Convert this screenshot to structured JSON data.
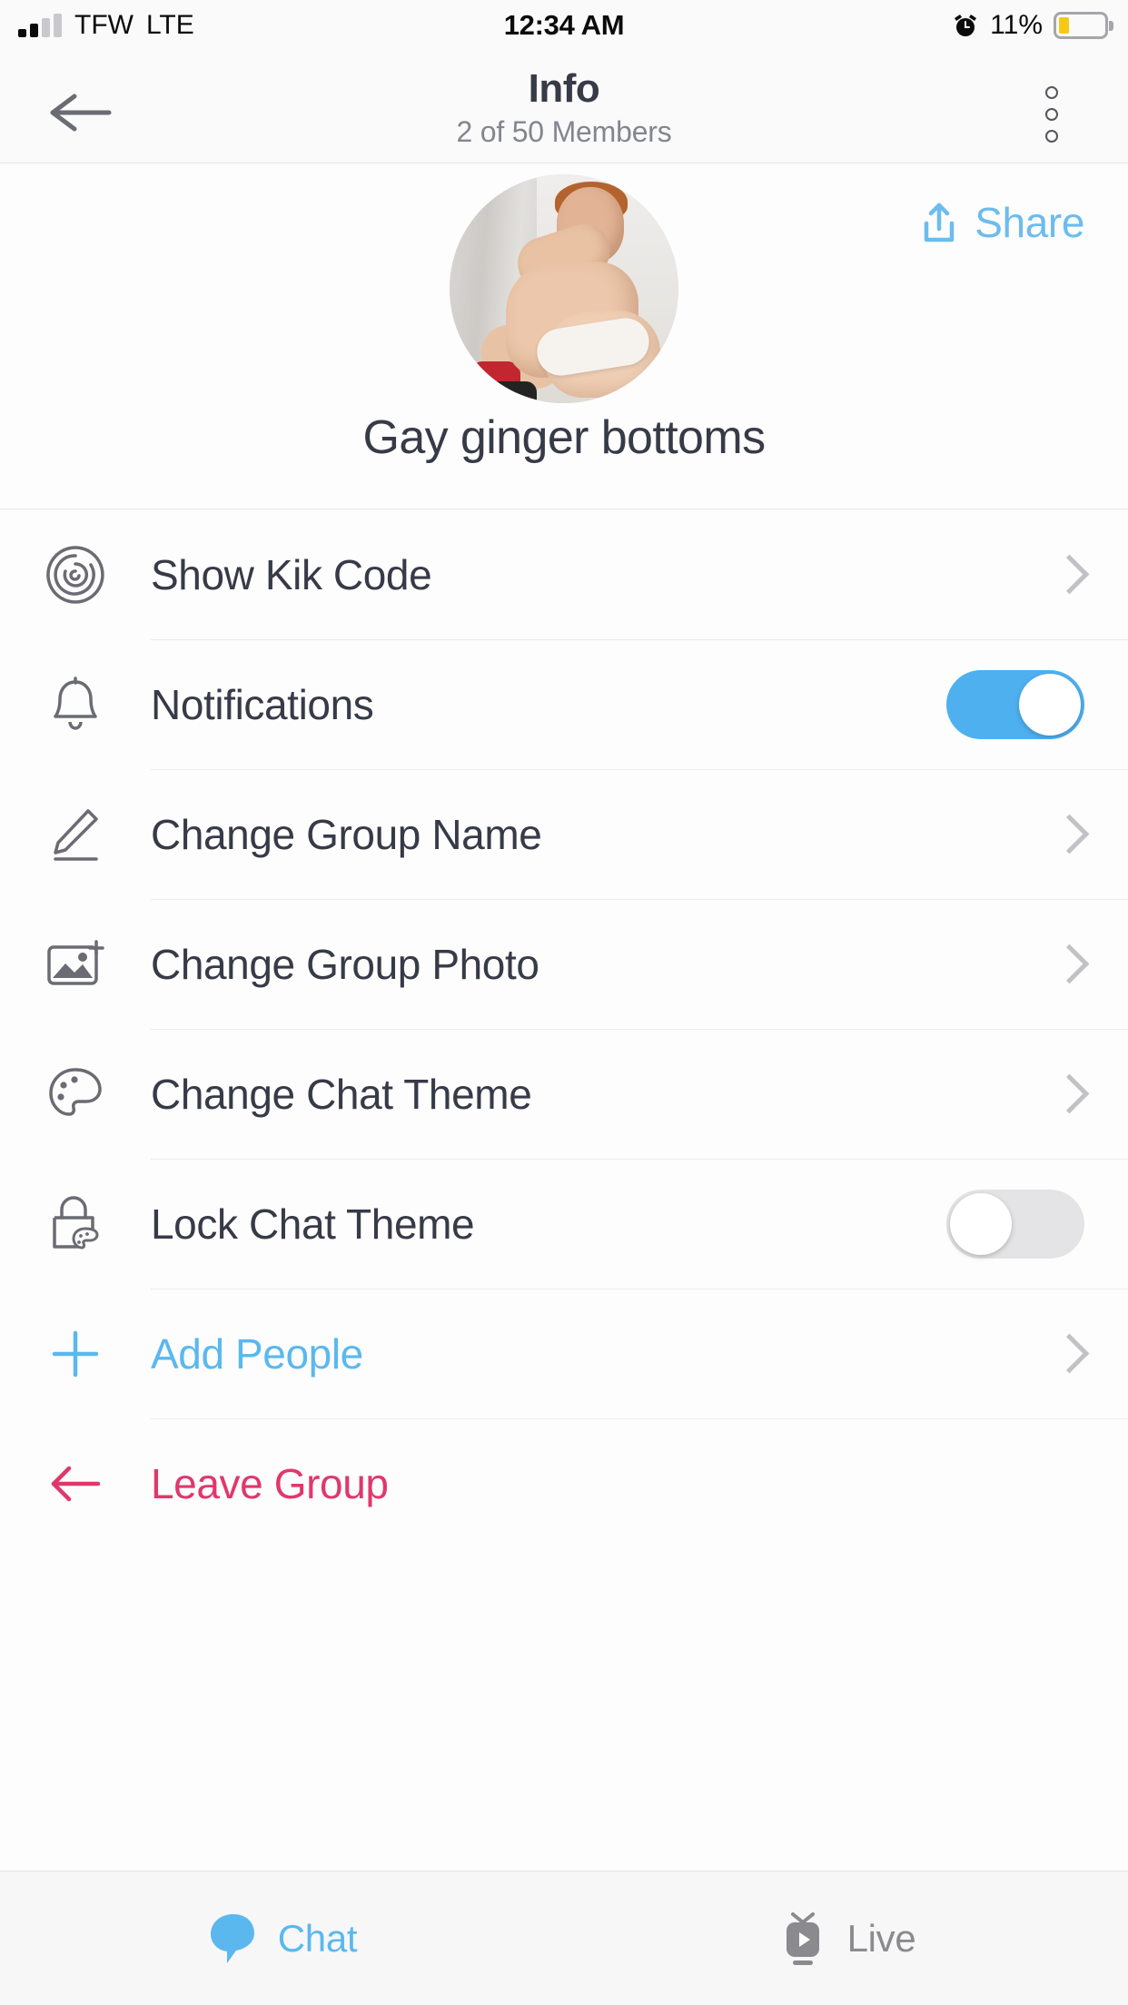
{
  "status_bar": {
    "carrier": "TFW",
    "network": "LTE",
    "time": "12:34 AM",
    "battery_percent": "11%",
    "signal_bars_filled": 2,
    "signal_bars_total": 4,
    "alarm_icon": "alarm-clock-icon",
    "battery_icon": "battery-low-icon",
    "battery_color": "#f6c914"
  },
  "nav": {
    "back_icon": "back-arrow-icon",
    "title": "Info",
    "subtitle": "2 of 50 Members",
    "menu_icon": "overflow-menu-icon"
  },
  "profile": {
    "share_label": "Share",
    "share_icon": "share-icon",
    "share_color": "#6cbcee",
    "avatar_icon": "group-avatar-photo",
    "group_name": "Gay ginger bottoms"
  },
  "settings": {
    "rows": [
      {
        "label": "Show Kik Code",
        "icon": "kik-code-icon",
        "accessory": "chevron",
        "style": "default"
      },
      {
        "label": "Notifications",
        "icon": "bell-icon",
        "accessory": "toggle",
        "style": "default",
        "toggle_on": true
      },
      {
        "label": "Change Group Name",
        "icon": "pencil-icon",
        "accessory": "chevron",
        "style": "default"
      },
      {
        "label": "Change Group Photo",
        "icon": "photo-add-icon",
        "accessory": "chevron",
        "style": "default"
      },
      {
        "label": "Change Chat Theme",
        "icon": "palette-icon",
        "accessory": "chevron",
        "style": "default"
      },
      {
        "label": "Lock Chat Theme",
        "icon": "lock-palette-icon",
        "accessory": "toggle",
        "style": "default",
        "toggle_on": false
      },
      {
        "label": "Add People",
        "icon": "plus-icon",
        "accessory": "chevron",
        "style": "blue"
      },
      {
        "label": "Leave Group",
        "icon": "leave-arrow-icon",
        "accessory": "none",
        "style": "pink"
      }
    ]
  },
  "tabbar": {
    "tabs": [
      {
        "label": "Chat",
        "icon": "chat-bubble-icon",
        "active": true
      },
      {
        "label": "Live",
        "icon": "live-video-icon",
        "active": false
      }
    ]
  },
  "colors": {
    "accent_blue": "#5bb8ef",
    "toggle_on": "#4fb0f0",
    "toggle_off": "#e4e4e6",
    "destructive_pink": "#e0386b",
    "text_primary": "#373a47",
    "text_secondary": "#83868f"
  }
}
